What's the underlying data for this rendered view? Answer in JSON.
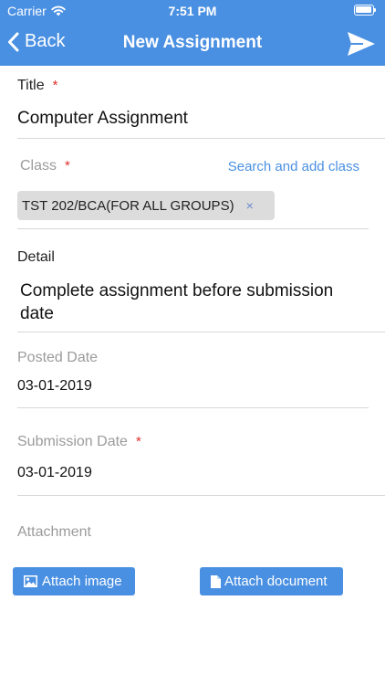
{
  "status_bar": {
    "carrier": "Carrier",
    "time": "7:51 PM"
  },
  "nav": {
    "back_label": "Back",
    "title": "New Assignment",
    "send_icon": "send-icon"
  },
  "form": {
    "required_marker": "*",
    "title": {
      "label": "Title",
      "value": "Computer Assignment"
    },
    "class": {
      "label": "Class",
      "search_link": "Search and add class",
      "chip": {
        "label": "TST 202/BCA(FOR ALL GROUPS)",
        "remove": "×"
      }
    },
    "detail": {
      "label": "Detail",
      "value": "Complete assignment before submission date"
    },
    "posted_date": {
      "label": "Posted Date",
      "value": "03-01-2019"
    },
    "submission_date": {
      "label": "Submission Date",
      "value": "03-01-2019"
    },
    "attachment": {
      "label": "Attachment",
      "image_button": "Attach image",
      "document_button": "Attach document"
    }
  },
  "colors": {
    "primary": "#4a90e2",
    "required": "#e0312f",
    "chip_bg": "#dcdcdc"
  }
}
